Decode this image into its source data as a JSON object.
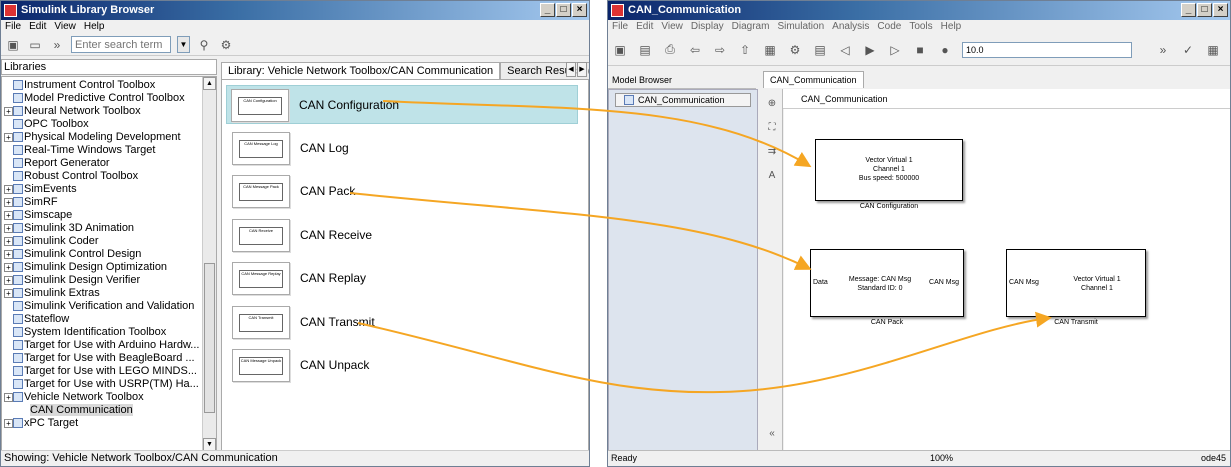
{
  "library_window": {
    "title": "Simulink Library Browser",
    "menu": [
      "File",
      "Edit",
      "View",
      "Help"
    ],
    "search_placeholder": "Enter search term",
    "tree_header": "Libraries",
    "tree_items": [
      {
        "label": "Instrument Control Toolbox",
        "expander": false
      },
      {
        "label": "Model Predictive Control Toolbox",
        "expander": false
      },
      {
        "label": "Neural Network Toolbox",
        "expander": true
      },
      {
        "label": "OPC Toolbox",
        "expander": false
      },
      {
        "label": "Physical Modeling Development",
        "expander": true
      },
      {
        "label": "Real-Time Windows Target",
        "expander": false
      },
      {
        "label": "Report Generator",
        "expander": false
      },
      {
        "label": "Robust Control Toolbox",
        "expander": false
      },
      {
        "label": "SimEvents",
        "expander": true
      },
      {
        "label": "SimRF",
        "expander": true
      },
      {
        "label": "Simscape",
        "expander": true
      },
      {
        "label": "Simulink 3D Animation",
        "expander": true
      },
      {
        "label": "Simulink Coder",
        "expander": true
      },
      {
        "label": "Simulink Control Design",
        "expander": true
      },
      {
        "label": "Simulink Design Optimization",
        "expander": true
      },
      {
        "label": "Simulink Design Verifier",
        "expander": true
      },
      {
        "label": "Simulink Extras",
        "expander": true
      },
      {
        "label": "Simulink Verification and Validation",
        "expander": false
      },
      {
        "label": "Stateflow",
        "expander": false
      },
      {
        "label": "System Identification Toolbox",
        "expander": false
      },
      {
        "label": "Target for Use with Arduino Hardw...",
        "expander": false
      },
      {
        "label": "Target for Use with BeagleBoard ...",
        "expander": false
      },
      {
        "label": "Target for Use with LEGO MINDS...",
        "expander": false
      },
      {
        "label": "Target for Use with USRP(TM) Ha...",
        "expander": false
      },
      {
        "label": "Vehicle Network Toolbox",
        "expander": true
      },
      {
        "label": "CAN Communication",
        "expander": false,
        "sub": true,
        "selected": true
      },
      {
        "label": "xPC Target",
        "expander": true
      }
    ],
    "tabs": [
      "Library: Vehicle Network Toolbox/CAN Communication",
      "Search Results: ("
    ],
    "blocks": [
      {
        "name": "CAN Configuration",
        "thumb": "CAN Configuration",
        "selected": true
      },
      {
        "name": "CAN Log",
        "thumb": "CAN Message Log",
        "selected": false
      },
      {
        "name": "CAN Pack",
        "thumb": "CAN Message Pack",
        "selected": false
      },
      {
        "name": "CAN Receive",
        "thumb": "CAN Receive",
        "selected": false
      },
      {
        "name": "CAN Replay",
        "thumb": "CAN Message Replay",
        "selected": false
      },
      {
        "name": "CAN Transmit",
        "thumb": "CAN Transmit",
        "selected": false
      },
      {
        "name": "CAN Unpack",
        "thumb": "CAN Message Unpack",
        "selected": false
      }
    ],
    "status": "Showing: Vehicle Network Toolbox/CAN Communication"
  },
  "model_window": {
    "title": "CAN_Communication",
    "menu": [
      "File",
      "Edit",
      "View",
      "Display",
      "Diagram",
      "Simulation",
      "Analysis",
      "Code",
      "Tools",
      "Help"
    ],
    "stop_time": "10.0",
    "browser_header": "Model Browser",
    "browser_item": "CAN_Communication",
    "canvas_tab": "CAN_Communication",
    "address": "CAN_Communication",
    "blocks": {
      "config": {
        "lines": [
          "Vector Virtual 1",
          "Channel 1",
          "Bus speed: 500000"
        ],
        "label": "CAN Configuration"
      },
      "pack": {
        "in_port": "Data",
        "body": [
          "Message: CAN Msg",
          "Standard ID: 0"
        ],
        "out_port": "CAN Msg",
        "label": "CAN Pack"
      },
      "transmit": {
        "in_port": "CAN Msg",
        "body": [
          "Vector Virtual 1",
          "Channel 1"
        ],
        "label": "CAN Transmit"
      }
    },
    "status_left": "Ready",
    "status_mid": "100%",
    "status_right": "ode45"
  },
  "colors": {
    "arrow": "#f5a623",
    "selection": "#bfe3e8"
  }
}
